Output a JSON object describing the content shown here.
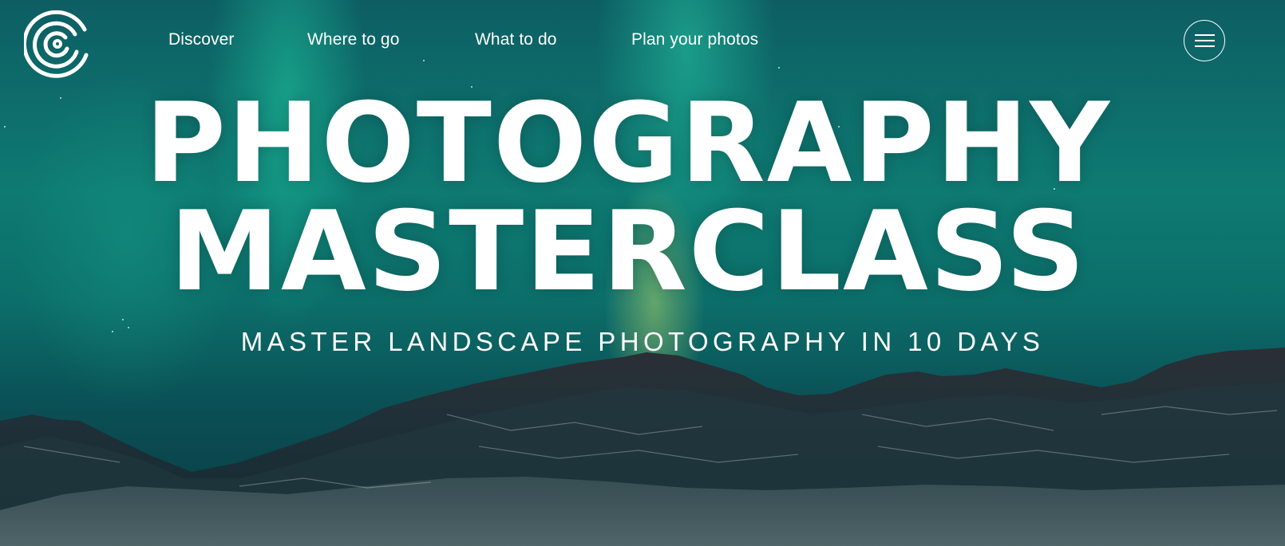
{
  "nav": {
    "links": [
      {
        "label": "Discover"
      },
      {
        "label": "Where to go"
      },
      {
        "label": "What to do"
      },
      {
        "label": "Plan your photos"
      }
    ],
    "menu_icon": "hamburger-menu-icon",
    "logo_icon": "concentric-circles-logo"
  },
  "hero": {
    "title_line1": "PHOTOGRAPHY",
    "title_line2": "MASTERCLASS",
    "subtitle": "MASTER LANDSCAPE PHOTOGRAPHY IN 10 DAYS"
  },
  "colors": {
    "text": "#ffffff",
    "sky_teal": "#0e7a72",
    "aurora_green": "#1ec8a0",
    "mountain_dark": "#1c2a30"
  }
}
